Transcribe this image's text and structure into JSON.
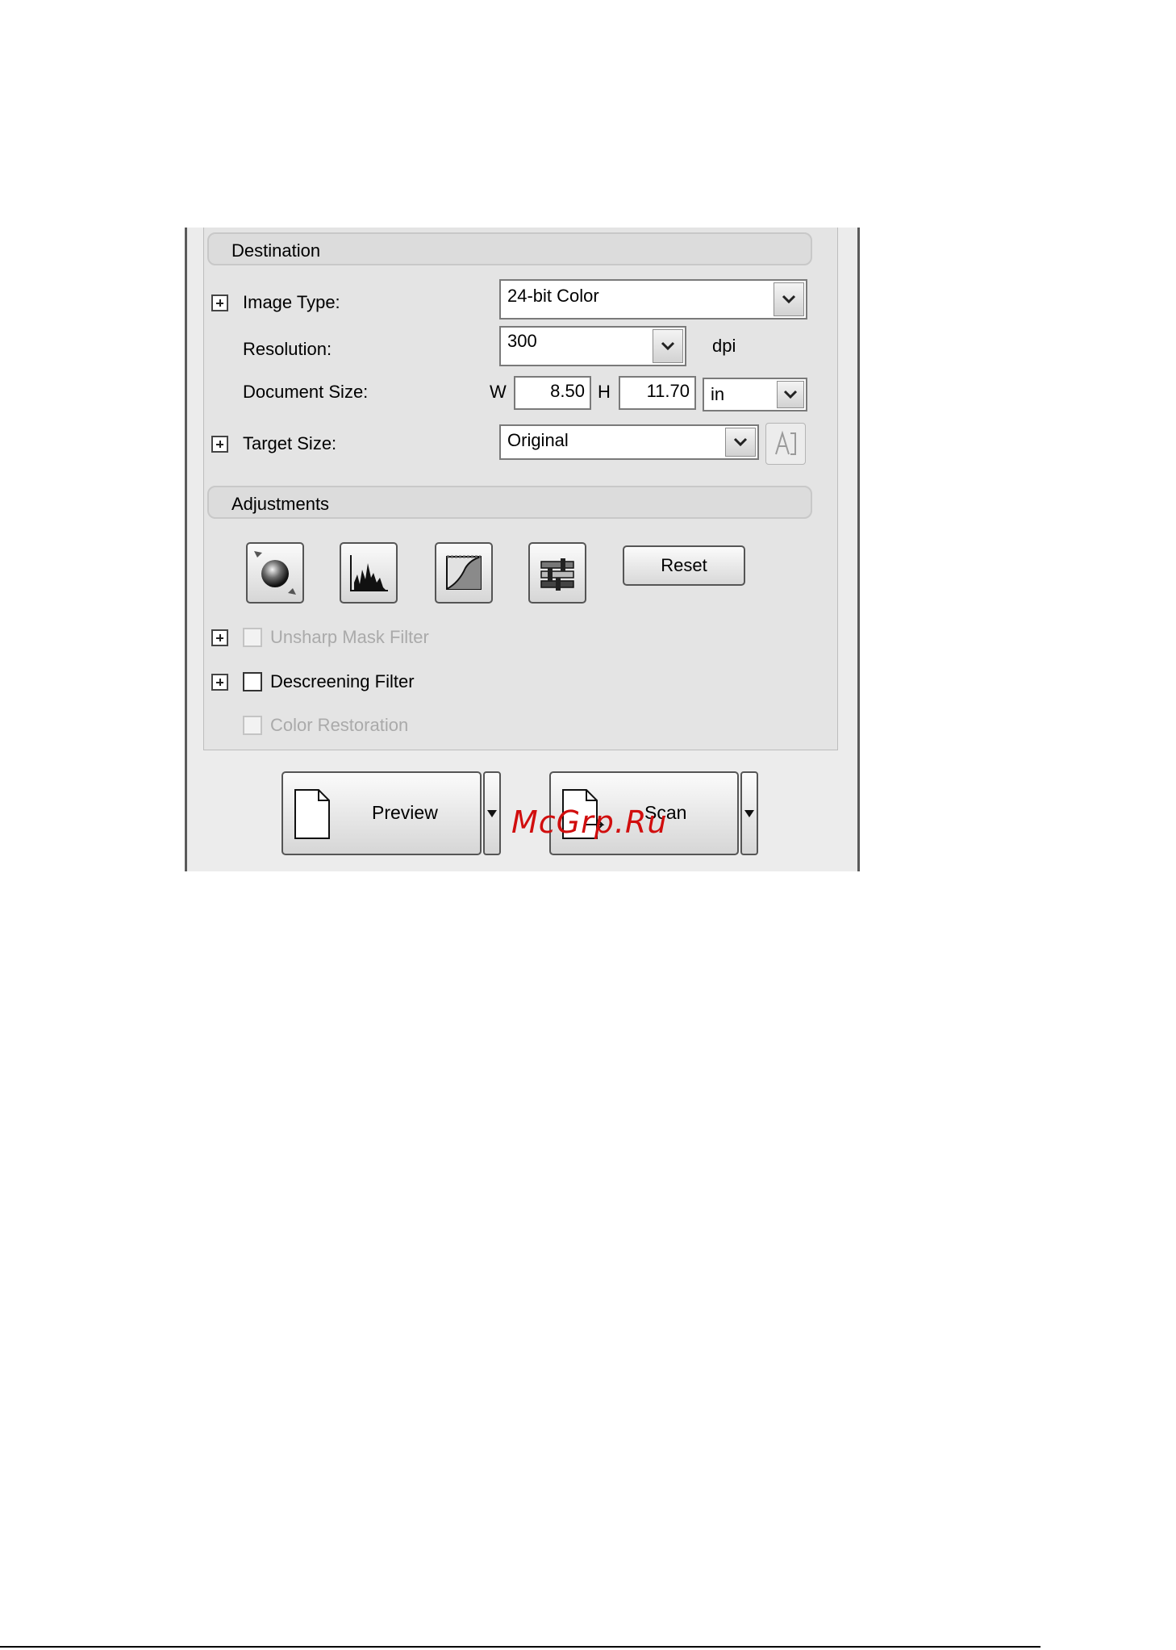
{
  "destination": {
    "header": "Destination",
    "image_type": {
      "label": "Image Type:",
      "value": "24-bit Color"
    },
    "resolution": {
      "label": "Resolution:",
      "value": "300",
      "unit": "dpi"
    },
    "document_size": {
      "label": "Document Size:",
      "w_label": "W",
      "w_value": "8.50",
      "h_label": "H",
      "h_value": "11.70",
      "unit": "in"
    },
    "target_size": {
      "label": "Target Size:",
      "value": "Original"
    }
  },
  "adjustments": {
    "header": "Adjustments",
    "tools": [
      "auto-exposure-icon",
      "histogram-icon",
      "tone-curve-icon",
      "color-palette-icon"
    ],
    "reset_label": "Reset",
    "unsharp_mask": {
      "label": "Unsharp Mask Filter",
      "checked": false,
      "enabled": false
    },
    "descreening": {
      "label": "Descreening Filter",
      "checked": false,
      "enabled": true
    },
    "color_restoration": {
      "label": "Color Restoration",
      "checked": false,
      "enabled": false
    }
  },
  "buttons": {
    "preview_label": "Preview",
    "scan_label": "Scan"
  },
  "watermark": "McGrp.Ru"
}
